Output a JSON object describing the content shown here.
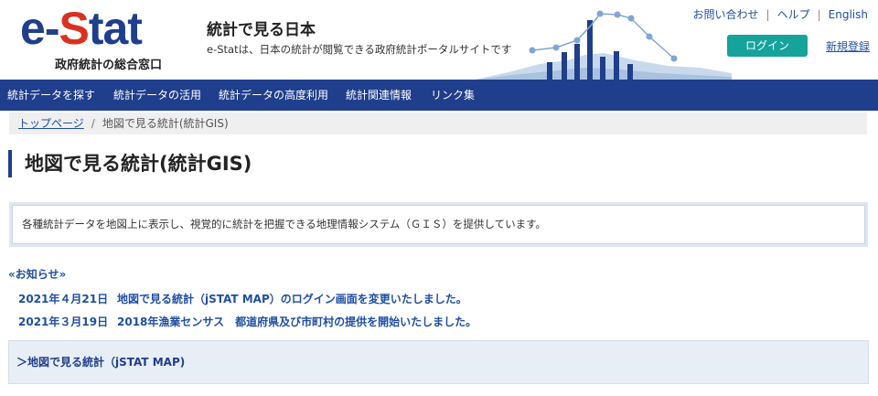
{
  "header": {
    "logo": {
      "mark_e": "e",
      "mark_dash": "-",
      "mark_s": "S",
      "mark_tat": "tat",
      "subtitle": "政府統計の総合窓口"
    },
    "site_title": "統計で見る日本",
    "site_description": "e-Statは、日本の統計が閲覧できる政府統計ポータルサイトです",
    "util_links": [
      "お問い合わせ",
      "ヘルプ",
      "English"
    ],
    "util_separator": "|",
    "login_label": "ログイン",
    "register_label": "新規登録"
  },
  "nav": {
    "items": [
      "統計データを探す",
      "統計データの活用",
      "統計データの高度利用",
      "統計関連情報",
      "リンク集"
    ]
  },
  "breadcrumb": {
    "home": "トップページ",
    "separator": "/",
    "current": "地図で見る統計(統計GIS)"
  },
  "main": {
    "page_title": "地図で見る統計(統計GIS)",
    "description": "各種統計データを地図上に表示し、視覚的に統計を把握できる地理情報システム（ＧＩＳ）を提供しています。"
  },
  "news": {
    "heading": "«お知らせ»",
    "items": [
      {
        "date": "2021年４月21日",
        "text": "地図で見る統計（jSTAT MAP）のログイン画面を変更いたしました。"
      },
      {
        "date": "2021年３月19日",
        "text": "2018年漁業センサス　都道府県及び市町村の提供を開始いたしました。"
      }
    ]
  },
  "accordion": {
    "label": "＞地図で見る統計（jSTAT MAP)"
  },
  "colors": {
    "brand_navy": "#1f3e8c",
    "brand_red": "#d9311f",
    "accent_teal": "#15a39b",
    "link_blue": "#1f4ea3"
  }
}
